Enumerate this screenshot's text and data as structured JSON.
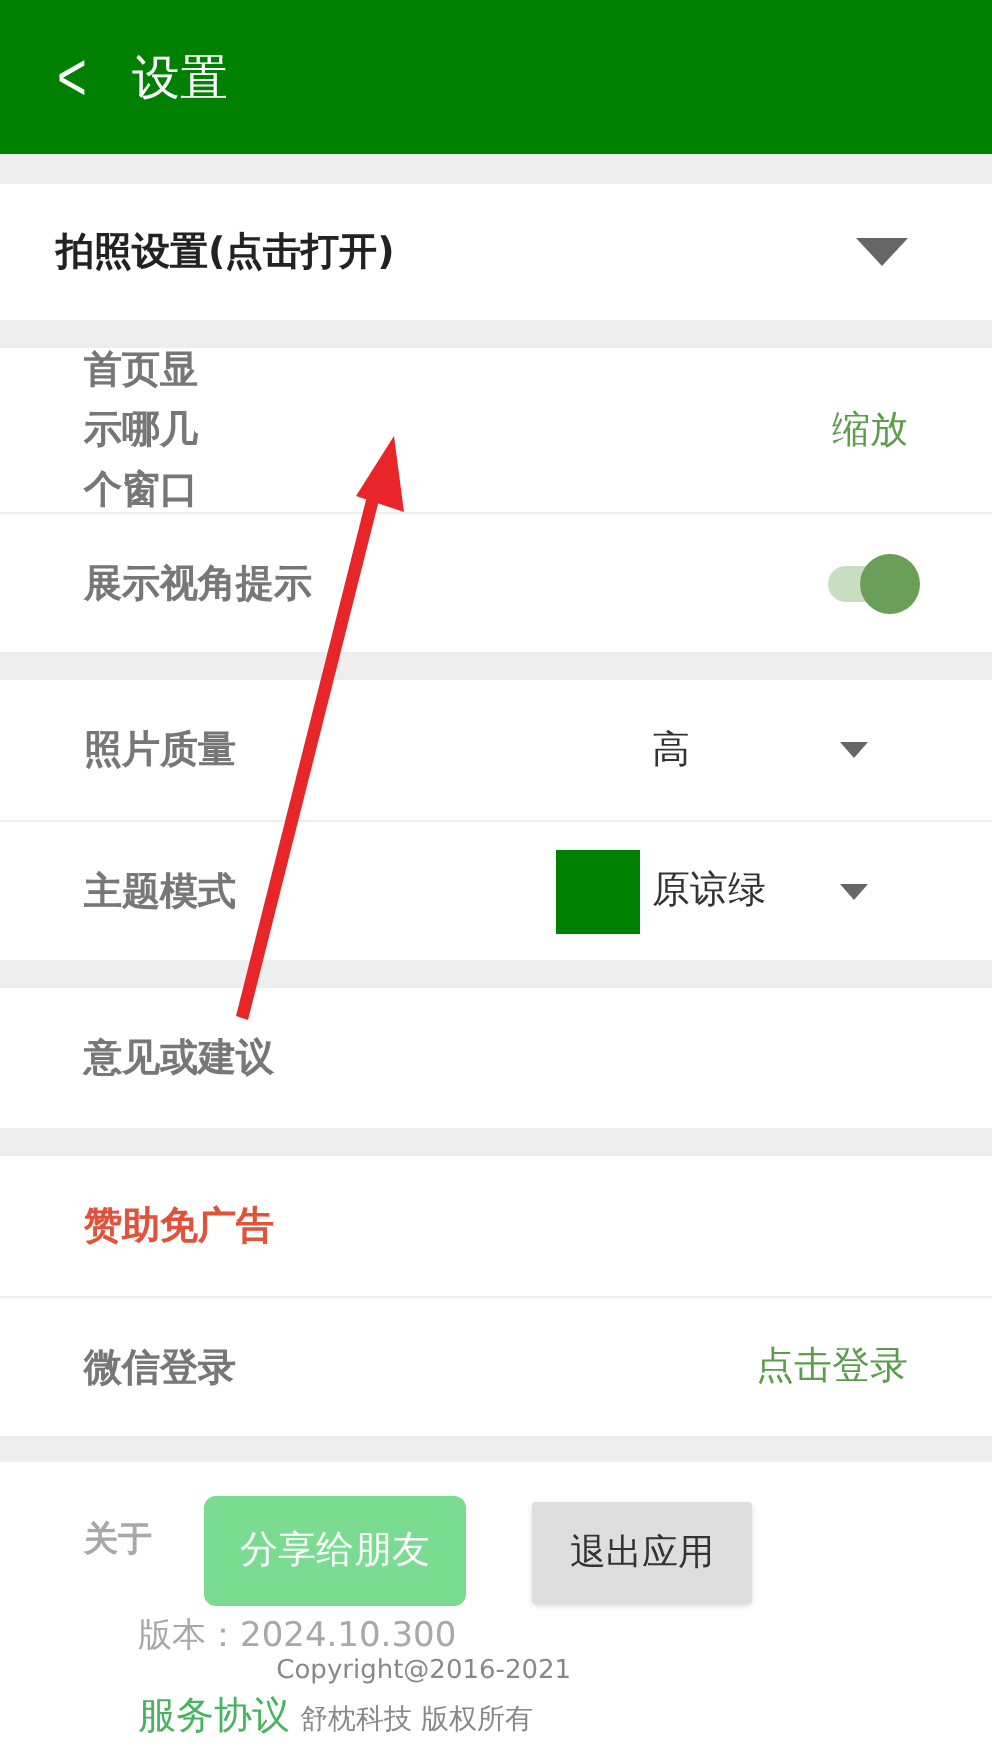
{
  "header": {
    "back": "<",
    "title": "设置"
  },
  "camera_section": {
    "label": "拍照设置(点击打开)",
    "expanded": false
  },
  "groups": [
    [
      {
        "kind": "value",
        "label": "首页显示哪几个窗口",
        "value": "缩放",
        "narrow": true
      },
      {
        "kind": "toggle",
        "label": "展示视角提示",
        "on": true
      }
    ],
    [
      {
        "kind": "select",
        "label": "照片质量",
        "value": "高"
      },
      {
        "kind": "select",
        "label": "主题模式",
        "value": "原谅绿",
        "color": "#008000"
      }
    ],
    [
      {
        "kind": "plain",
        "label": "意见或建议"
      }
    ],
    [
      {
        "kind": "plain",
        "label": "赞助免广告",
        "accent": true
      },
      {
        "kind": "value",
        "label": "微信登录",
        "value": "点击登录"
      }
    ]
  ],
  "about": {
    "label": "关于",
    "share_button": "分享给朋友",
    "exit_button": "退出应用",
    "version": "版本：2024.10.300",
    "copyright": "Copyright@2016-2021",
    "terms_link": "服务协议",
    "rights": "舒枕科技 版权所有"
  }
}
